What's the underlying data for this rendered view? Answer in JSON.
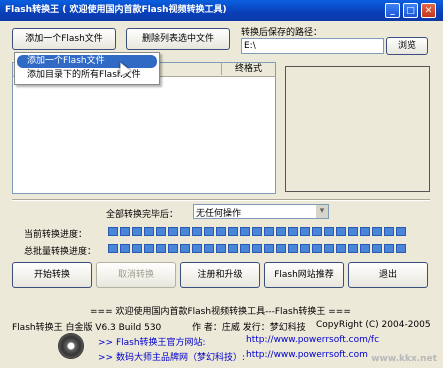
{
  "titlebar": {
    "title": "Flash转换王 ( 欢迎使用国内首款Flash视频转换工具)",
    "min_glyph": "_",
    "max_glyph": "□",
    "close_glyph": "✕"
  },
  "toolbar": {
    "add_flash_label": "添加一个Flash文件",
    "delete_selected_label": "删除列表选中文件"
  },
  "dropdown_menu": {
    "items": [
      "添加一个Flash文件",
      "添加目录下的所有Flash文件"
    ],
    "selected_index": 0
  },
  "list": {
    "column_format": "终格式"
  },
  "output": {
    "path_label": "转换后保存的路径：",
    "path_value": "E:\\",
    "browse_label": "浏览"
  },
  "after_convert": {
    "label": "全部转换完毕后：",
    "selected_option": "无任何操作",
    "arrow_glyph": "▾"
  },
  "progress": {
    "current_label": "当前转换进度：",
    "current_fraction": 1.0,
    "total_label": "总批量转换进度：",
    "total_fraction": 1.0
  },
  "actions": {
    "start_label": "开始转换",
    "cancel_label": "取消转换",
    "register_label": "注册和升级",
    "recommend_label": "Flash网站推荐",
    "exit_label": "退出"
  },
  "footer": {
    "banner": "=== 欢迎使用国内首款Flash视频转换工具---Flash转换王 ===",
    "product": "Flash转换王 白金版 V6.3 Build 530",
    "author": "作 者：庄威 发行：梦幻科技",
    "copyright": "CopyRight (C) 2004-2005",
    "link1_label": ">> Flash转换王官方网站:",
    "link1_url": "http://www.powerrsoft.com/fc",
    "link2_label": ">> 数码大师主品牌网（梦幻科技）:",
    "link2_url": "http://www.powerrsoft.com"
  },
  "watermark": "www.kkx.net",
  "colors": {
    "titlebar": "#0a3fb8",
    "window_bg": "#ece9d8",
    "menu_highlight": "#316ac5",
    "progress_fill": "#4a86d8",
    "link": "#0000cc"
  }
}
